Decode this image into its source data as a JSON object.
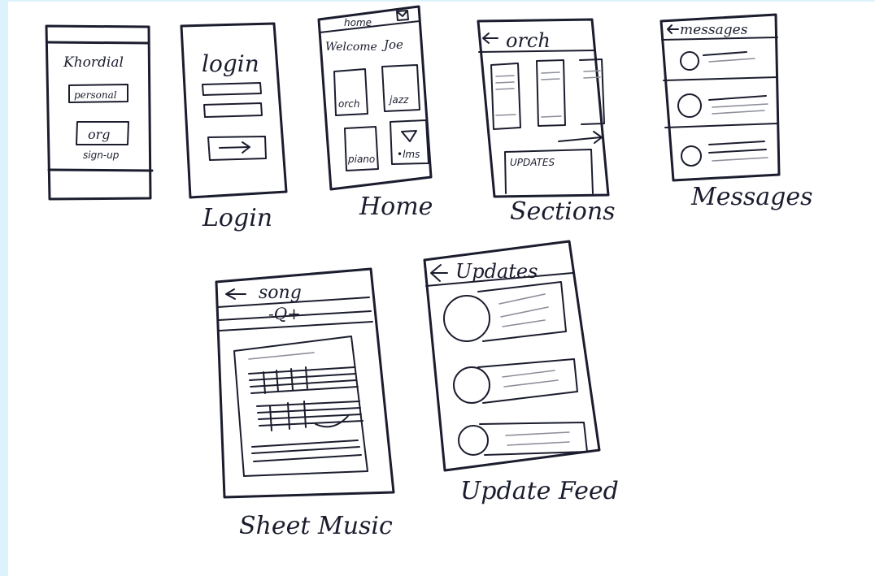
{
  "sketches": {
    "signup": {
      "brand": "Khordial",
      "personal": "personal",
      "org": "org",
      "signup": "sign-up"
    },
    "login": {
      "title": "login",
      "caption": "Login"
    },
    "home": {
      "tab": "home",
      "welcome": "Welcome",
      "user": "Joe",
      "tiles": [
        "orch",
        "jazz",
        "piano",
        "•lms"
      ],
      "caption": "Home"
    },
    "sections": {
      "title": "orch",
      "updates": "UPDATES",
      "caption": "Sections"
    },
    "messages": {
      "title": "messages",
      "caption": "Messages"
    },
    "sheet_music": {
      "title": "song",
      "zoom": "-Q+",
      "caption": "Sheet Music"
    },
    "update_feed": {
      "title": "Updates",
      "caption": "Update Feed"
    }
  },
  "colors": {
    "ink": "#1b1d2e",
    "paper": "#ffffff",
    "background": "#ddf3fb"
  }
}
